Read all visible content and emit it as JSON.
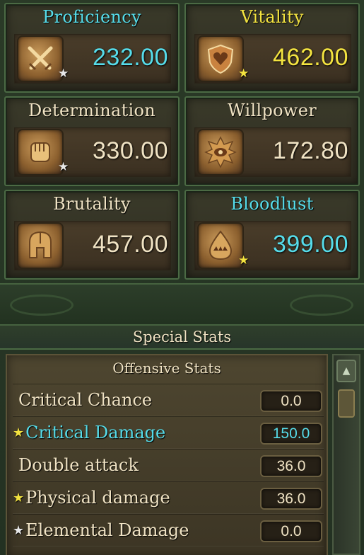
{
  "attributes": [
    {
      "name": "Proficiency",
      "value": "232.00",
      "icon": "crossed-swords-icon",
      "name_color": "#56dcea",
      "value_color": "#56dcea",
      "star": "white"
    },
    {
      "name": "Vitality",
      "value": "462.00",
      "icon": "heart-shield-icon",
      "name_color": "#f3e340",
      "value_color": "#f3e340",
      "star": "gold"
    },
    {
      "name": "Determination",
      "value": "330.00",
      "icon": "fist-icon",
      "name_color": "#f0e3c4",
      "value_color": "#f0e3c4",
      "star": "white"
    },
    {
      "name": "Willpower",
      "value": "172.80",
      "icon": "eye-burst-icon",
      "name_color": "#f0e3c4",
      "value_color": "#f0e3c4",
      "star": "none"
    },
    {
      "name": "Brutality",
      "value": "457.00",
      "icon": "helmet-icon",
      "name_color": "#f0e3c4",
      "value_color": "#f0e3c4",
      "star": "none"
    },
    {
      "name": "Bloodlust",
      "value": "399.00",
      "icon": "fang-drop-icon",
      "name_color": "#56dcea",
      "value_color": "#56dcea",
      "star": "gold"
    }
  ],
  "special_stats": {
    "title": "Special Stats",
    "section": "Offensive Stats",
    "rows": [
      {
        "label": "Critical Chance",
        "value": "0.0",
        "star": "none",
        "label_color": "#f0e3c4",
        "value_color": "#f0e3c4"
      },
      {
        "label": "Critical Damage",
        "value": "150.0",
        "star": "gold",
        "label_color": "#56dcea",
        "value_color": "#56dcea"
      },
      {
        "label": "Double attack",
        "value": "36.0",
        "star": "none",
        "label_color": "#f0e3c4",
        "value_color": "#f0e3c4"
      },
      {
        "label": "Physical damage",
        "value": "36.0",
        "star": "gold",
        "label_color": "#f0e3c4",
        "value_color": "#f0e3c4"
      },
      {
        "label": "Elemental Damage",
        "value": "0.0",
        "star": "white",
        "label_color": "#f0e3c4",
        "value_color": "#f0e3c4"
      }
    ]
  },
  "scrollbar": {
    "up_icon": "scroll-up-icon"
  }
}
